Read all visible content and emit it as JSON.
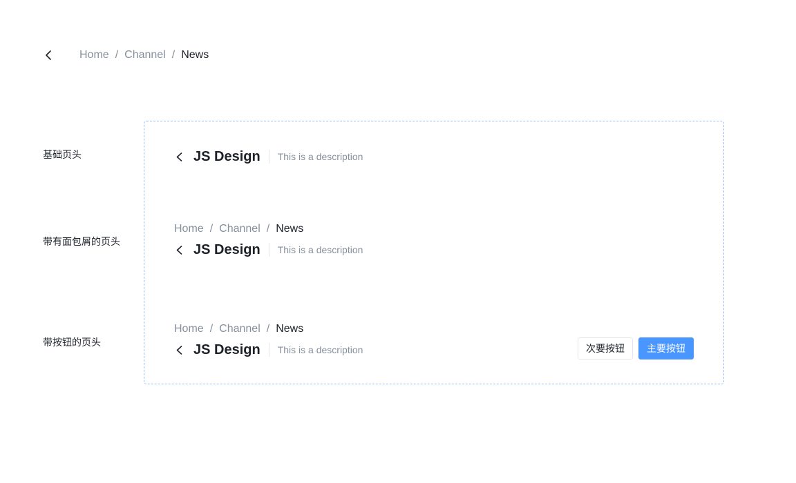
{
  "top": {
    "breadcrumb": [
      "Home",
      "Channel",
      "News"
    ]
  },
  "separator": "/",
  "rows": [
    {
      "label": "基础页头"
    },
    {
      "label": "带有面包屑的页头"
    },
    {
      "label": "带按钮的页头"
    }
  ],
  "page_headers": [
    {
      "title": "JS Design",
      "description": "This is a description"
    },
    {
      "breadcrumb": [
        "Home",
        "Channel",
        "News"
      ],
      "title": "JS Design",
      "description": "This is a description"
    },
    {
      "breadcrumb": [
        "Home",
        "Channel",
        "News"
      ],
      "title": "JS Design",
      "description": "This is a description"
    }
  ],
  "buttons": {
    "secondary": "次要按钮",
    "primary": "主要按钮"
  },
  "colors": {
    "primary": "#4a96ff",
    "frame_border": "#94bfff",
    "muted_text": "#86909c",
    "text": "#1d2129"
  },
  "icons": {
    "back": "chevron-left-icon"
  }
}
